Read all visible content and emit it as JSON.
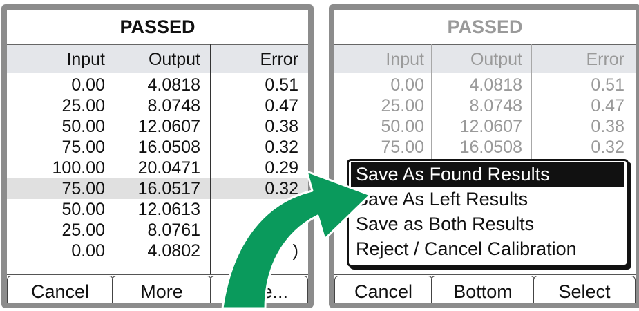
{
  "colors": {
    "arrow_green": "#0a9a5c",
    "bezel": "#8c8c8c",
    "highlight_row": "#e0e0e0",
    "selected_menu": "#111111"
  },
  "left_screen": {
    "title": "PASSED",
    "headers": [
      "Input",
      "Output",
      "Error"
    ],
    "rows": [
      [
        "0.00",
        "4.0818",
        "0.51"
      ],
      [
        "25.00",
        "8.0748",
        "0.47"
      ],
      [
        "50.00",
        "12.0607",
        "0.38"
      ],
      [
        "75.00",
        "16.0508",
        "0.32"
      ],
      [
        "100.00",
        "20.0471",
        "0.29"
      ],
      [
        "75.00",
        "16.0517",
        "0.32"
      ],
      [
        "50.00",
        "12.0613",
        ""
      ],
      [
        "25.00",
        "8.0761",
        ""
      ],
      [
        "0.00",
        "4.0802",
        ")"
      ]
    ],
    "highlighted_row_index": 5,
    "softkeys": [
      "Cancel",
      "More",
      "Save..."
    ]
  },
  "right_screen": {
    "title": "PASSED",
    "headers": [
      "Input",
      "Output",
      "Error"
    ],
    "rows": [
      [
        "0.00",
        "4.0818",
        "0.51"
      ],
      [
        "25.00",
        "8.0748",
        "0.47"
      ],
      [
        "50.00",
        "12.0607",
        "0.38"
      ],
      [
        "75.00",
        "16.0508",
        "0.32"
      ]
    ],
    "menu": [
      "Save As Found Results",
      "Save As Left Results",
      "Save as Both Results",
      "Reject / Cancel Calibration"
    ],
    "selected_menu_index": 0,
    "softkeys": [
      "Cancel",
      "Bottom",
      "Select"
    ]
  }
}
